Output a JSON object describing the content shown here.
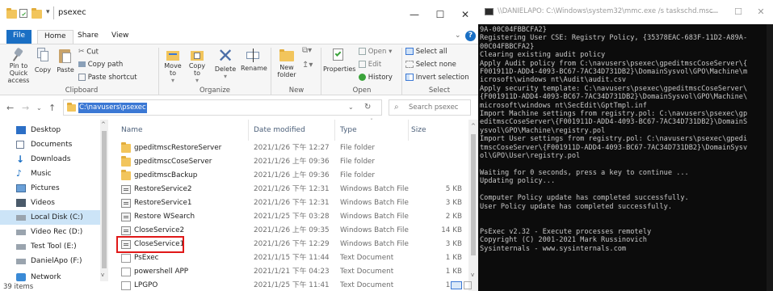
{
  "explorer": {
    "title": "psexec",
    "tabs": [
      "File",
      "Home",
      "Share",
      "View"
    ],
    "ribbon": {
      "pin_quick_access": "Pin to Quick access",
      "copy": "Copy",
      "paste": "Paste",
      "cut": "Cut",
      "copy_path": "Copy path",
      "paste_shortcut": "Paste shortcut",
      "move_to": "Move to",
      "copy_to": "Copy to",
      "delete": "Delete",
      "rename": "Rename",
      "new_folder": "New folder",
      "properties": "Properties",
      "open": "Open",
      "edit": "Edit",
      "history": "History",
      "select_all": "Select all",
      "select_none": "Select none",
      "invert_selection": "Invert selection",
      "groups": [
        "Clipboard",
        "Organize",
        "New",
        "Open",
        "Select"
      ]
    },
    "address": "C:\\navusers\\psexec",
    "search_placeholder": "Search psexec",
    "nav_items": [
      "Desktop",
      "Documents",
      "Downloads",
      "Music",
      "Pictures",
      "Videos",
      "Local Disk (C:)",
      "Video Rec (D:)",
      "Test Tool (E:)",
      "DanielApo (F:)",
      "Network"
    ],
    "columns": [
      "Name",
      "Date modified",
      "Type",
      "Size"
    ],
    "files": [
      {
        "name": "gpeditmscRestoreServer",
        "date": "2021/1/26 下午 12:27",
        "type": "File folder",
        "size": "",
        "kind": "folder"
      },
      {
        "name": "gpeditmscCoseServer",
        "date": "2021/1/26 上午 09:36",
        "type": "File folder",
        "size": "",
        "kind": "folder"
      },
      {
        "name": "gpeditmscBackup",
        "date": "2021/1/26 上午 09:36",
        "type": "File folder",
        "size": "",
        "kind": "folder"
      },
      {
        "name": "RestoreService2",
        "date": "2021/1/26 下午 12:31",
        "type": "Windows Batch File",
        "size": "5 KB",
        "kind": "batch"
      },
      {
        "name": "RestoreService1",
        "date": "2021/1/26 下午 12:31",
        "type": "Windows Batch File",
        "size": "3 KB",
        "kind": "batch"
      },
      {
        "name": "Restore WSearch",
        "date": "2021/1/25 下午 03:28",
        "type": "Windows Batch File",
        "size": "2 KB",
        "kind": "batch"
      },
      {
        "name": "CloseService2",
        "date": "2021/1/26 上午 09:35",
        "type": "Windows Batch File",
        "size": "14 KB",
        "kind": "batch"
      },
      {
        "name": "CloseService1",
        "date": "2021/1/26 下午 12:29",
        "type": "Windows Batch File",
        "size": "3 KB",
        "kind": "batch"
      },
      {
        "name": "PsExec",
        "date": "2021/1/15 下午 11:44",
        "type": "Text Document",
        "size": "1 KB",
        "kind": "text"
      },
      {
        "name": "powershell APP",
        "date": "2021/1/21 下午 04:23",
        "type": "Text Document",
        "size": "1 KB",
        "kind": "text"
      },
      {
        "name": "LPGPO",
        "date": "2021/1/25 下午 11:41",
        "type": "Text Document",
        "size": "1 KB",
        "kind": "text"
      }
    ],
    "status": "39 items"
  },
  "console": {
    "title": "\\\\DANIELAPO: C:\\Windows\\system32\\mmc.exe /s taskschd.msc",
    "lines": [
      "9A-00C04FBBCFA2}",
      "Registering User CSE: Registry Policy, {35378EAC-683F-11D2-A89A-",
      "00C04FBBCFA2}",
      "Clearing existing audit policy",
      "Apply Audit policy from C:\\navusers\\psexec\\gpeditmscCoseServer\\{",
      "F001911D-ADD4-4093-BC67-7AC34D731DB2}\\DomainSysvol\\GPO\\Machine\\m",
      "icrosoft\\windows nt\\Audit\\audit.csv",
      "Apply security template: C:\\navusers\\psexec\\gpeditmscCoseServer\\",
      "{F001911D-ADD4-4093-BC67-7AC34D731DB2}\\DomainSysvol\\GPO\\Machine\\",
      "microsoft\\windows nt\\SecEdit\\GptTmpl.inf",
      "Import Machine settings from registry.pol: C:\\navusers\\psexec\\gp",
      "editmscCoseServer\\{F001911D-ADD4-4093-BC67-7AC34D731DB2}\\DomainS",
      "ysvol\\GPO\\Machine\\registry.pol",
      "Import User settings from registry.pol: C:\\navusers\\psexec\\gpedi",
      "tmscCoseServer\\{F001911D-ADD4-4093-BC67-7AC34D731DB2}\\DomainSysv",
      "ol\\GPO\\User\\registry.pol",
      "",
      "Waiting for 0 seconds, press a key to continue ...",
      "Updating policy...",
      "",
      "Computer Policy update has completed successfully.",
      "User Policy update has completed successfully.",
      "",
      "",
      "PsExec v2.32 - Execute processes remotely",
      "Copyright (C) 2001-2021 Mark Russinovich",
      "Sysinternals - www.sysinternals.com"
    ]
  },
  "colors": {
    "accent": "#1a6fc4",
    "highlight_box": "#e01818",
    "console_bg": "#0c0c0c"
  }
}
